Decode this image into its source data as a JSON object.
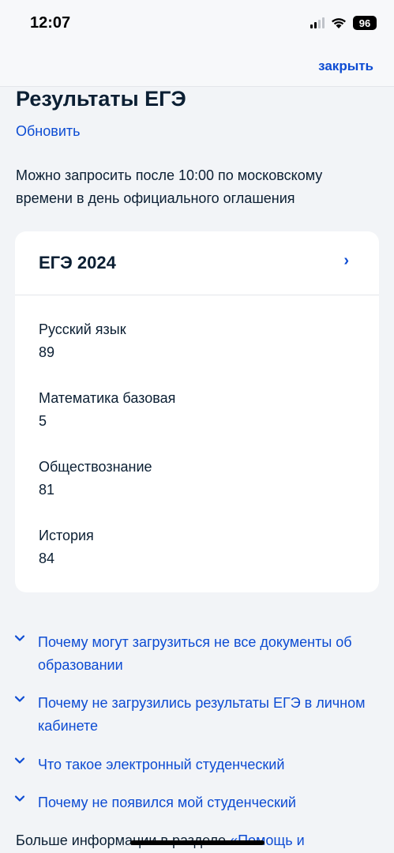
{
  "status": {
    "time": "12:07",
    "battery": "96"
  },
  "header": {
    "close_label": "закрыть"
  },
  "page": {
    "title": "Результаты ЕГЭ",
    "refresh_label": "Обновить",
    "info": "Можно запросить после 10:00 по московскому времени в день официального оглашения"
  },
  "card": {
    "title": "ЕГЭ 2024",
    "subjects": [
      {
        "name": "Русский язык",
        "score": "89"
      },
      {
        "name": "Математика базовая",
        "score": "5"
      },
      {
        "name": "Обществознание",
        "score": "81"
      },
      {
        "name": "История",
        "score": "84"
      }
    ]
  },
  "faq": [
    "Почему могут загрузиться не все документы об образовании",
    "Почему не загрузились результаты ЕГЭ в личном кабинете",
    "Что такое электронный студенческий",
    "Почему не появился мой студенческий"
  ],
  "footer": {
    "text": "Больше информации в разделе ",
    "link": "«Помощь и"
  }
}
